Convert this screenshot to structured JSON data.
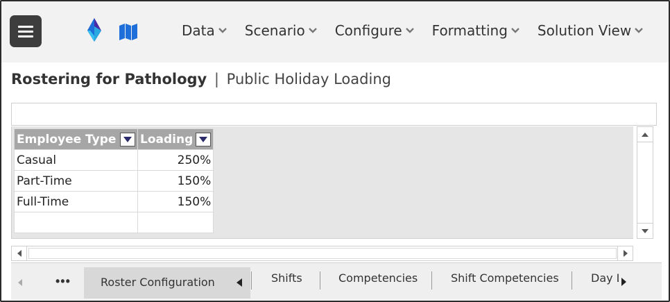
{
  "header": {
    "menu": [
      {
        "label": "Data"
      },
      {
        "label": "Scenario"
      },
      {
        "label": "Configure"
      },
      {
        "label": "Formatting"
      },
      {
        "label": "Solution View"
      }
    ]
  },
  "title": {
    "app": "Rostering for Pathology",
    "separator": "|",
    "page": "Public Holiday Loading"
  },
  "table": {
    "columns": [
      "Employee Type",
      "Loading"
    ],
    "rows": [
      [
        "Casual",
        "250%"
      ],
      [
        "Part-Time",
        "150%"
      ],
      [
        "Full-Time",
        "150%"
      ],
      [
        "",
        ""
      ]
    ]
  },
  "tabs": {
    "more": "•••",
    "items": [
      {
        "label": "Roster Configuration",
        "active": true
      },
      {
        "label": "Shifts"
      },
      {
        "label": "Competencies"
      },
      {
        "label": "Shift Competencies"
      },
      {
        "label": "Day L"
      }
    ]
  },
  "icons": {
    "menu": "hamburger-icon",
    "logo": "app-logo",
    "map": "map-icon",
    "chevron": "chevron-down-icon",
    "filter": "filter-dropdown-icon"
  },
  "colors": {
    "header_bg": "#f2f2f2",
    "hamburger_bg": "#3d3d3d",
    "table_header_bg": "#a6a6a6",
    "grid_bg": "#e6e6e6",
    "logo_blue": "#1e6fd9",
    "logo_purple": "#4b2aa8"
  }
}
